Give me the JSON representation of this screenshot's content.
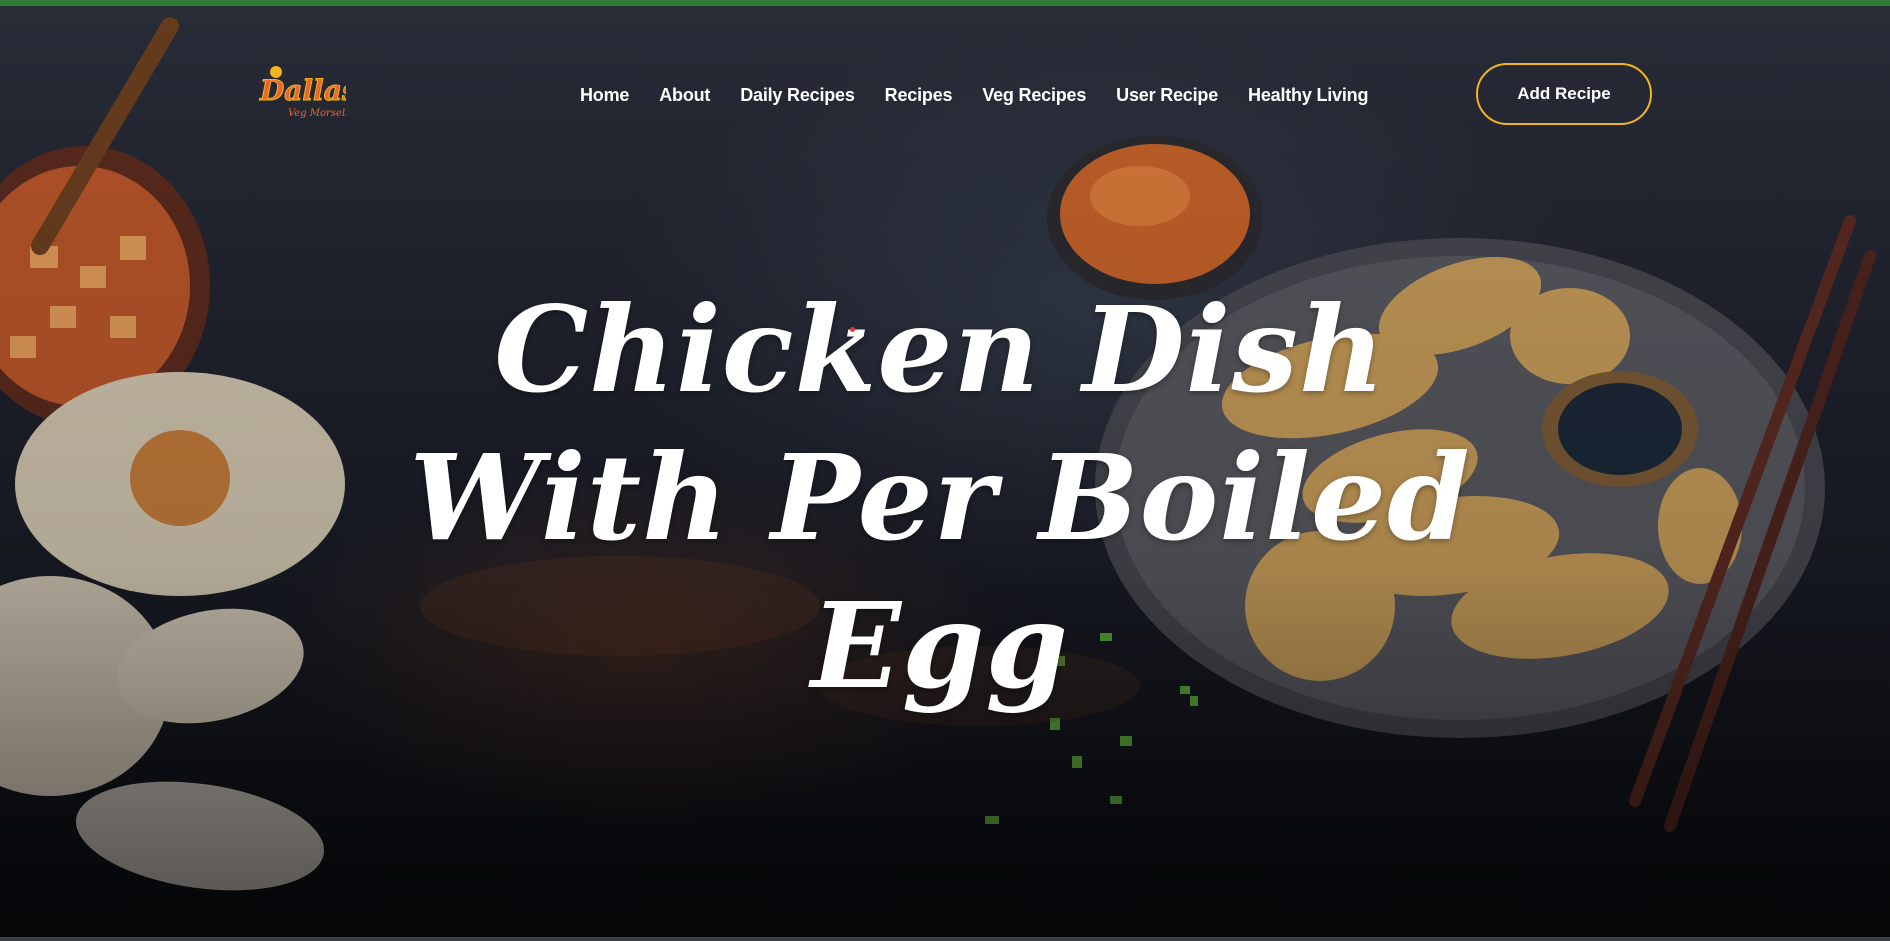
{
  "brand": {
    "logo_text": "Dallas",
    "logo_subtext": "Veg Morsels",
    "accent_color": "#f2b51f",
    "logo_color": "#e8682a",
    "top_bar_color": "#2e7d32"
  },
  "nav": {
    "items": [
      {
        "label": "Home"
      },
      {
        "label": "About"
      },
      {
        "label": "Daily Recipes"
      },
      {
        "label": "Recipes"
      },
      {
        "label": "Veg Recipes"
      },
      {
        "label": "User Recipe"
      },
      {
        "label": "Healthy Living"
      }
    ]
  },
  "header": {
    "cta_label": "Add Recipe"
  },
  "hero": {
    "title": "Chicken Dish With Per Boiled Egg"
  }
}
